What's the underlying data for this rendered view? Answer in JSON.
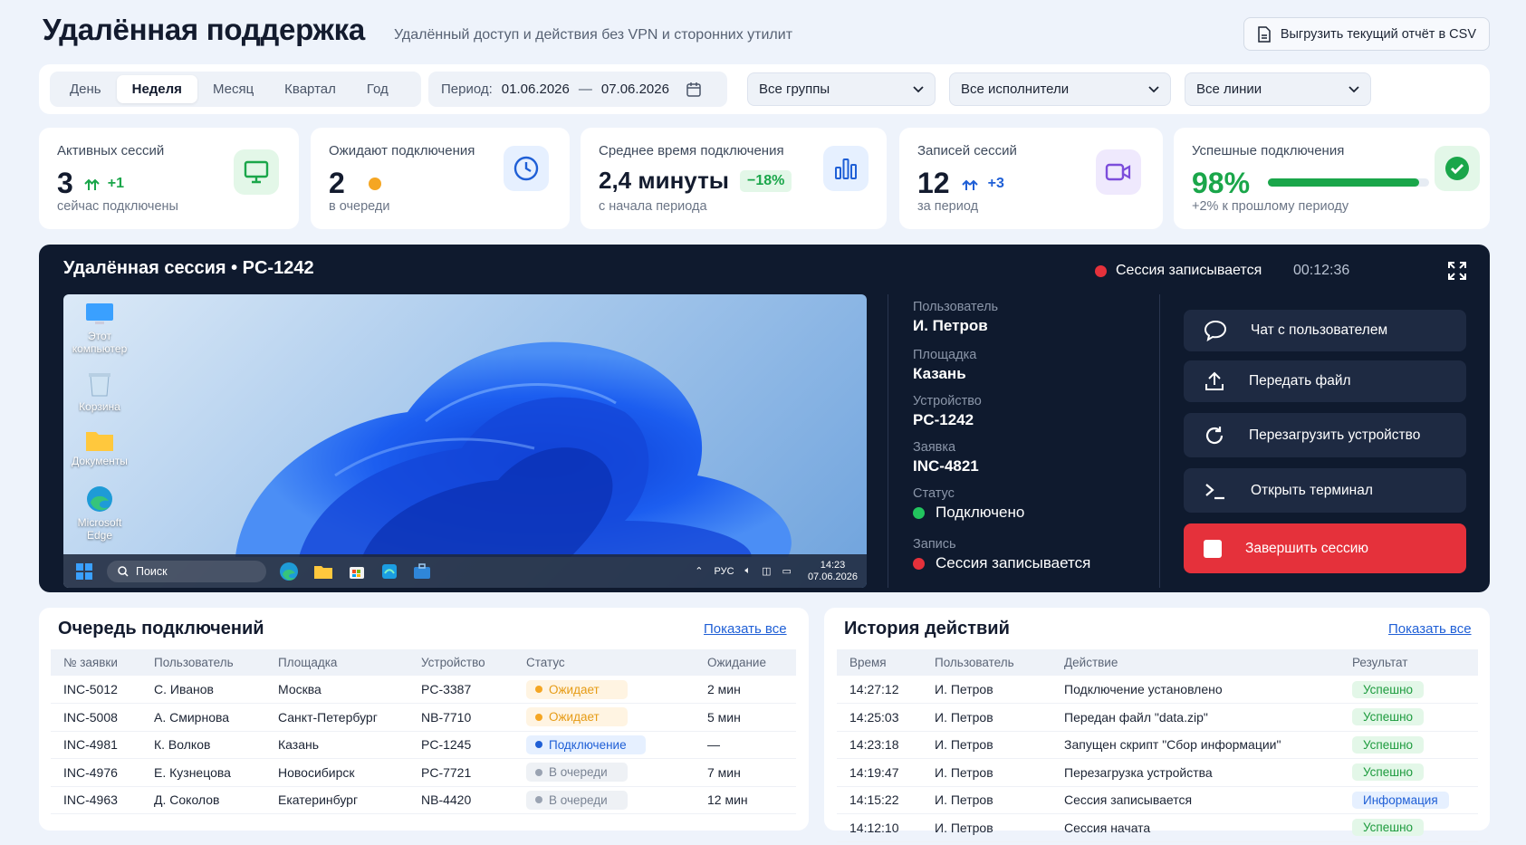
{
  "header": {
    "title": "Удалённая поддержка",
    "subtitle": "Удалённый доступ и действия без VPN и сторонних утилит",
    "export_label": "Выгрузить текущий отчёт в CSV"
  },
  "filters": {
    "periods": [
      "День",
      "Неделя",
      "Месяц",
      "Квартал",
      "Год"
    ],
    "active_period": "Неделя",
    "period_label": "Период:",
    "date_from": "01.06.2026",
    "date_sep": "—",
    "date_to": "07.06.2026",
    "groups": "Все группы",
    "executors": "Все исполнители",
    "lines": "Все линии"
  },
  "stats": {
    "active": {
      "label": "Активных сессий",
      "value": "3",
      "delta": "+1",
      "sub": "сейчас подключены",
      "icon": "monitor-icon"
    },
    "waiting": {
      "label": "Ожидают подключения",
      "value": "2",
      "sub": "в очереди",
      "icon": "clock-icon"
    },
    "avg": {
      "label": "Среднее время подключения",
      "value": "2,4 минуты",
      "delta": "−18%",
      "sub": "с начала периода",
      "icon": "bar-chart-icon"
    },
    "records": {
      "label": "Записей сессий",
      "value": "12",
      "delta": "+3",
      "sub": "за период",
      "icon": "video-icon"
    },
    "success": {
      "label": "Успешные подключения",
      "value": "98%",
      "progress": 0.94,
      "sub": "+2% к прошлому периоду",
      "icon": "check-circle-icon"
    }
  },
  "colors": {
    "accent": "#1f5fd6",
    "success": "#1aa64a",
    "danger": "#e5313b",
    "warning": "#f5a623",
    "panel_dark": "#0f1a2e"
  },
  "session": {
    "title": "Удалённая сессия • PC-1242",
    "recording_label": "Сессия записывается",
    "timer": "00:12:36",
    "desktop": {
      "icons": [
        {
          "label": "Этот\nкомпьютер"
        },
        {
          "label": "Корзина"
        },
        {
          "label": "Документы"
        },
        {
          "label": "Microsoft\nEdge"
        }
      ],
      "search": "Поиск",
      "lang": "РУС",
      "time": "14:23",
      "date": "07.06.2026"
    },
    "info": [
      {
        "label": "Пользователь",
        "value": "И. Петров"
      },
      {
        "label": "Площадка",
        "value": "Казань"
      },
      {
        "label": "Устройство",
        "value": "PC-1242"
      },
      {
        "label": "Заявка",
        "value": "INC-4821"
      },
      {
        "label": "Статус",
        "value": "Подключено"
      },
      {
        "label": "Запись",
        "value": "Сессия записывается"
      }
    ],
    "actions": [
      {
        "label": "Чат с пользователем",
        "icon": "chat-icon"
      },
      {
        "label": "Передать файл",
        "icon": "upload-icon"
      },
      {
        "label": "Перезагрузить устройство",
        "icon": "restart-icon"
      },
      {
        "label": "Открыть терминал",
        "icon": "terminal-icon"
      },
      {
        "label": "Завершить сессию",
        "icon": "stop-icon"
      }
    ]
  },
  "queue": {
    "title": "Очередь подключений",
    "show_all": "Показать все",
    "columns": [
      "№ заявки",
      "Пользователь",
      "Площадка",
      "Устройство",
      "Статус",
      "Ожидание"
    ],
    "rows": [
      {
        "id": "INC-5012",
        "user": "С. Иванов",
        "site": "Москва",
        "device": "PC-3387",
        "status": "Ожидает",
        "kind": "wait",
        "wait": "2 мин"
      },
      {
        "id": "INC-5008",
        "user": "А. Смирнова",
        "site": "Санкт-Петербург",
        "device": "NB-7710",
        "status": "Ожидает",
        "kind": "wait",
        "wait": "5 мин"
      },
      {
        "id": "INC-4981",
        "user": "К. Волков",
        "site": "Казань",
        "device": "PC-1245",
        "status": "Подключение",
        "kind": "conn",
        "wait": "—"
      },
      {
        "id": "INC-4976",
        "user": "Е. Кузнецова",
        "site": "Новосибирск",
        "device": "PC-7721",
        "status": "В очереди",
        "kind": "queue",
        "wait": "7 мин"
      },
      {
        "id": "INC-4963",
        "user": "Д. Соколов",
        "site": "Екатеринбург",
        "device": "NB-4420",
        "status": "В очереди",
        "kind": "queue",
        "wait": "12 мин"
      }
    ]
  },
  "history": {
    "title": "История действий",
    "show_all": "Показать все",
    "columns": [
      "Время",
      "Пользователь",
      "Действие",
      "Результат"
    ],
    "rows": [
      {
        "time": "14:27:12",
        "user": "И. Петров",
        "action": "Подключение установлено",
        "result": "Успешно",
        "kind": "ok"
      },
      {
        "time": "14:25:03",
        "user": "И. Петров",
        "action": "Передан файл \"data.zip\"",
        "result": "Успешно",
        "kind": "ok"
      },
      {
        "time": "14:23:18",
        "user": "И. Петров",
        "action": "Запущен скрипт \"Сбор информации\"",
        "result": "Успешно",
        "kind": "ok"
      },
      {
        "time": "14:19:47",
        "user": "И. Петров",
        "action": "Перезагрузка устройства",
        "result": "Успешно",
        "kind": "ok"
      },
      {
        "time": "14:15:22",
        "user": "И. Петров",
        "action": "Сессия записывается",
        "result": "Информация",
        "kind": "info"
      },
      {
        "time": "14:12:10",
        "user": "И. Петров",
        "action": "Сессия начата",
        "result": "Успешно",
        "kind": "ok"
      }
    ]
  }
}
